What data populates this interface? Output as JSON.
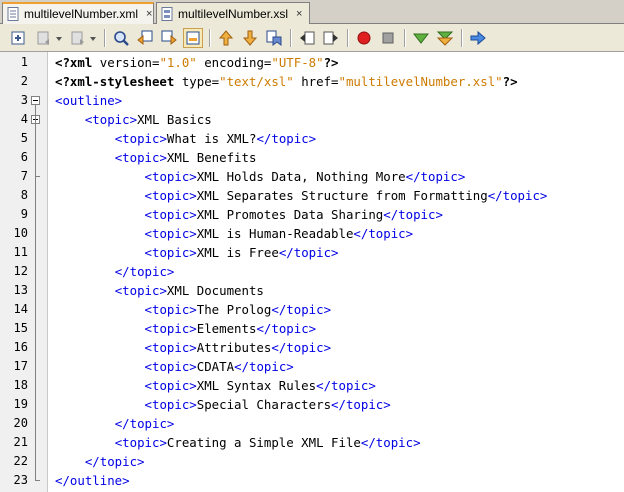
{
  "tabs": [
    {
      "label": "multilevelNumber.xml",
      "close": "×",
      "active": true
    },
    {
      "label": "multilevelNumber.xsl",
      "close": "×",
      "active": false
    }
  ],
  "toolbar": {
    "icons": [
      "source-history-icon",
      "back-icon",
      "forward-icon",
      "find-icon",
      "find-previous-icon",
      "find-next-icon",
      "toggle-highlight-icon",
      "previous-bookmark-icon",
      "next-bookmark-icon",
      "toggle-bookmark-icon",
      "shift-left-icon",
      "shift-right-icon",
      "record-macro-icon",
      "stop-macro-icon",
      "check-xml-icon",
      "validate-xml-icon",
      "xsl-transform-icon"
    ]
  },
  "editor": {
    "lines": [
      {
        "n": "1",
        "segs": [
          [
            "pi",
            "<?xml"
          ],
          [
            "attr",
            " version="
          ],
          [
            "val",
            "\"1.0\""
          ],
          [
            "attr",
            " encoding="
          ],
          [
            "val",
            "\"UTF-8\""
          ],
          [
            "pi",
            "?>"
          ]
        ]
      },
      {
        "n": "2",
        "segs": [
          [
            "pi",
            "<?xml-stylesheet"
          ],
          [
            "attr",
            " type="
          ],
          [
            "val",
            "\"text/xsl\""
          ],
          [
            "attr",
            " href="
          ],
          [
            "val",
            "\"multilevelNumber.xsl\""
          ],
          [
            "pi",
            "?>"
          ]
        ]
      },
      {
        "n": "3",
        "segs": [
          [
            "tag",
            "<outline>"
          ]
        ]
      },
      {
        "n": "4",
        "segs": [
          [
            "txt",
            "    "
          ],
          [
            "tag",
            "<topic>"
          ],
          [
            "txt",
            "XML Basics"
          ]
        ]
      },
      {
        "n": "5",
        "segs": [
          [
            "txt",
            "        "
          ],
          [
            "tag",
            "<topic>"
          ],
          [
            "txt",
            "What is XML?"
          ],
          [
            "tag",
            "</topic>"
          ]
        ]
      },
      {
        "n": "6",
        "segs": [
          [
            "txt",
            "        "
          ],
          [
            "tag",
            "<topic>"
          ],
          [
            "txt",
            "XML Benefits"
          ]
        ]
      },
      {
        "n": "7",
        "segs": [
          [
            "txt",
            "            "
          ],
          [
            "tag",
            "<topic>"
          ],
          [
            "txt",
            "XML Holds Data, Nothing More"
          ],
          [
            "tag",
            "</topic>"
          ]
        ]
      },
      {
        "n": "8",
        "segs": [
          [
            "txt",
            "            "
          ],
          [
            "tag",
            "<topic>"
          ],
          [
            "txt",
            "XML Separates Structure from Formatting"
          ],
          [
            "tag",
            "</topic>"
          ]
        ]
      },
      {
        "n": "9",
        "segs": [
          [
            "txt",
            "            "
          ],
          [
            "tag",
            "<topic>"
          ],
          [
            "txt",
            "XML Promotes Data Sharing"
          ],
          [
            "tag",
            "</topic>"
          ]
        ]
      },
      {
        "n": "10",
        "segs": [
          [
            "txt",
            "            "
          ],
          [
            "tag",
            "<topic>"
          ],
          [
            "txt",
            "XML is Human-Readable"
          ],
          [
            "tag",
            "</topic>"
          ]
        ]
      },
      {
        "n": "11",
        "segs": [
          [
            "txt",
            "            "
          ],
          [
            "tag",
            "<topic>"
          ],
          [
            "txt",
            "XML is Free"
          ],
          [
            "tag",
            "</topic>"
          ]
        ]
      },
      {
        "n": "12",
        "segs": [
          [
            "txt",
            "        "
          ],
          [
            "tag",
            "</topic>"
          ]
        ]
      },
      {
        "n": "13",
        "segs": [
          [
            "txt",
            "        "
          ],
          [
            "tag",
            "<topic>"
          ],
          [
            "txt",
            "XML Documents"
          ]
        ]
      },
      {
        "n": "14",
        "segs": [
          [
            "txt",
            "            "
          ],
          [
            "tag",
            "<topic>"
          ],
          [
            "txt",
            "The Prolog"
          ],
          [
            "tag",
            "</topic>"
          ]
        ]
      },
      {
        "n": "15",
        "segs": [
          [
            "txt",
            "            "
          ],
          [
            "tag",
            "<topic>"
          ],
          [
            "txt",
            "Elements"
          ],
          [
            "tag",
            "</topic>"
          ]
        ]
      },
      {
        "n": "16",
        "segs": [
          [
            "txt",
            "            "
          ],
          [
            "tag",
            "<topic>"
          ],
          [
            "txt",
            "Attributes"
          ],
          [
            "tag",
            "</topic>"
          ]
        ]
      },
      {
        "n": "17",
        "segs": [
          [
            "txt",
            "            "
          ],
          [
            "tag",
            "<topic>"
          ],
          [
            "txt",
            "CDATA"
          ],
          [
            "tag",
            "</topic>"
          ]
        ]
      },
      {
        "n": "18",
        "segs": [
          [
            "txt",
            "            "
          ],
          [
            "tag",
            "<topic>"
          ],
          [
            "txt",
            "XML Syntax Rules"
          ],
          [
            "tag",
            "</topic>"
          ]
        ]
      },
      {
        "n": "19",
        "segs": [
          [
            "txt",
            "            "
          ],
          [
            "tag",
            "<topic>"
          ],
          [
            "txt",
            "Special Characters"
          ],
          [
            "tag",
            "</topic>"
          ]
        ]
      },
      {
        "n": "20",
        "segs": [
          [
            "txt",
            "        "
          ],
          [
            "tag",
            "</topic>"
          ]
        ]
      },
      {
        "n": "21",
        "segs": [
          [
            "txt",
            "        "
          ],
          [
            "tag",
            "<topic>"
          ],
          [
            "txt",
            "Creating a Simple XML File"
          ],
          [
            "tag",
            "</topic>"
          ]
        ]
      },
      {
        "n": "22",
        "segs": [
          [
            "txt",
            "    "
          ],
          [
            "tag",
            "</topic>"
          ]
        ]
      },
      {
        "n": "23",
        "segs": [
          [
            "tag",
            "</outline>"
          ]
        ]
      }
    ]
  },
  "colors": {
    "tag": "#0000e6",
    "value": "#ce7b00",
    "text": "#000000",
    "tab_accent": "#f0a030"
  }
}
